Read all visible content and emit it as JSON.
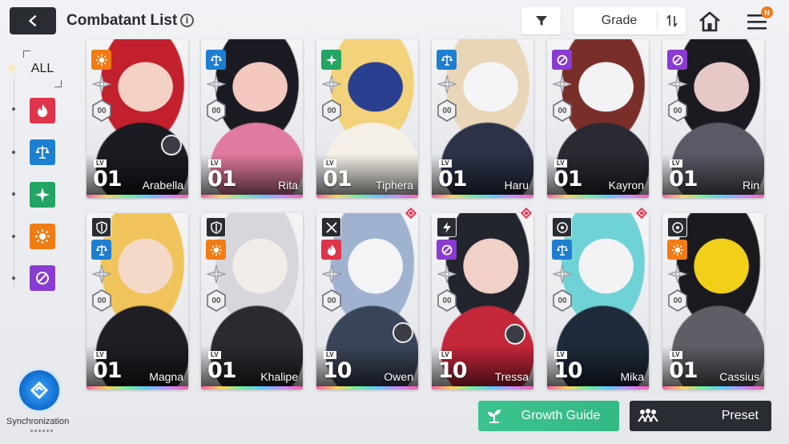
{
  "header": {
    "title": "Combatant List",
    "info_icon": "info-icon",
    "grade_label": "Grade",
    "notification_badge": "N"
  },
  "sidebar": {
    "all_label": "ALL",
    "elements": [
      {
        "name": "fire",
        "color": "#e0344a"
      },
      {
        "name": "order",
        "color": "#1e7fd0"
      },
      {
        "name": "wind",
        "color": "#23a563"
      },
      {
        "name": "light",
        "color": "#f07c13"
      },
      {
        "name": "void",
        "color": "#8a3bd1"
      }
    ],
    "sync_label": "Synchronization"
  },
  "cards": [
    {
      "name": "Arabella",
      "lv_tag": "LV",
      "level": "01",
      "element": "light",
      "slot": "00",
      "new": false,
      "art": [
        "#c2202c",
        "#f3d1c5",
        "#1b1b22"
      ]
    },
    {
      "name": "Rita",
      "lv_tag": "LV",
      "level": "01",
      "element": "order",
      "slot": "00",
      "new": false,
      "art": [
        "#1a1a22",
        "#f2c8bf",
        "#e07aa0"
      ]
    },
    {
      "name": "Tiphera",
      "lv_tag": "LV",
      "level": "01",
      "element": "wind",
      "slot": "00",
      "new": false,
      "art": [
        "#f2d27a",
        "#2a3f8f",
        "#f5f1e8"
      ]
    },
    {
      "name": "Haru",
      "lv_tag": "LV",
      "level": "01",
      "element": "order",
      "slot": "00",
      "new": false,
      "art": [
        "#e9d6b8",
        "#f5f5f7",
        "#2c3348"
      ]
    },
    {
      "name": "Kayron",
      "lv_tag": "LV",
      "level": "01",
      "element": "void",
      "slot": "00",
      "new": false,
      "art": [
        "#7a2e2a",
        "#f2f2f4",
        "#2a2a33"
      ]
    },
    {
      "name": "Rin",
      "lv_tag": "LV",
      "level": "01",
      "element": "void",
      "slot": "00",
      "new": false,
      "art": [
        "#1a1a20",
        "#e6c8c6",
        "#5a5a66"
      ]
    },
    {
      "name": "Magna",
      "lv_tag": "LV",
      "level": "01",
      "element": "order",
      "slot": "00",
      "new": false,
      "role_icon": "shield-icon",
      "art": [
        "#f0c45a",
        "#f4d8c8",
        "#1e1e24"
      ]
    },
    {
      "name": "Khalipe",
      "lv_tag": "LV",
      "level": "01",
      "element": "light",
      "slot": "00",
      "new": false,
      "role_icon": "shield-icon",
      "art": [
        "#d6d6dc",
        "#f2ece8",
        "#2a2a30"
      ]
    },
    {
      "name": "Owen",
      "lv_tag": "LV",
      "level": "10",
      "element": "fire",
      "slot": "00",
      "new": true,
      "role_icon": "swords-icon",
      "art": [
        "#9fb2cf",
        "#f4f4f6",
        "#3a4458"
      ]
    },
    {
      "name": "Tressa",
      "lv_tag": "LV",
      "level": "10",
      "element": "void",
      "slot": "00",
      "new": true,
      "role_icon": "lightning-icon",
      "art": [
        "#22242e",
        "#f1d0c8",
        "#c4263a"
      ]
    },
    {
      "name": "Mika",
      "lv_tag": "LV",
      "level": "10",
      "element": "order",
      "slot": "00",
      "new": true,
      "role_icon": "target-icon",
      "art": [
        "#6fd2d6",
        "#f3f3f5",
        "#1f2a3a"
      ]
    },
    {
      "name": "Cassius",
      "lv_tag": "LV",
      "level": "01",
      "element": "light",
      "slot": "00",
      "new": false,
      "role_icon": "target-icon",
      "art": [
        "#1a1a1e",
        "#f2d01a",
        "#5e5e66"
      ]
    }
  ],
  "footer": {
    "growth_label": "Growth Guide",
    "preset_label": "Preset"
  }
}
